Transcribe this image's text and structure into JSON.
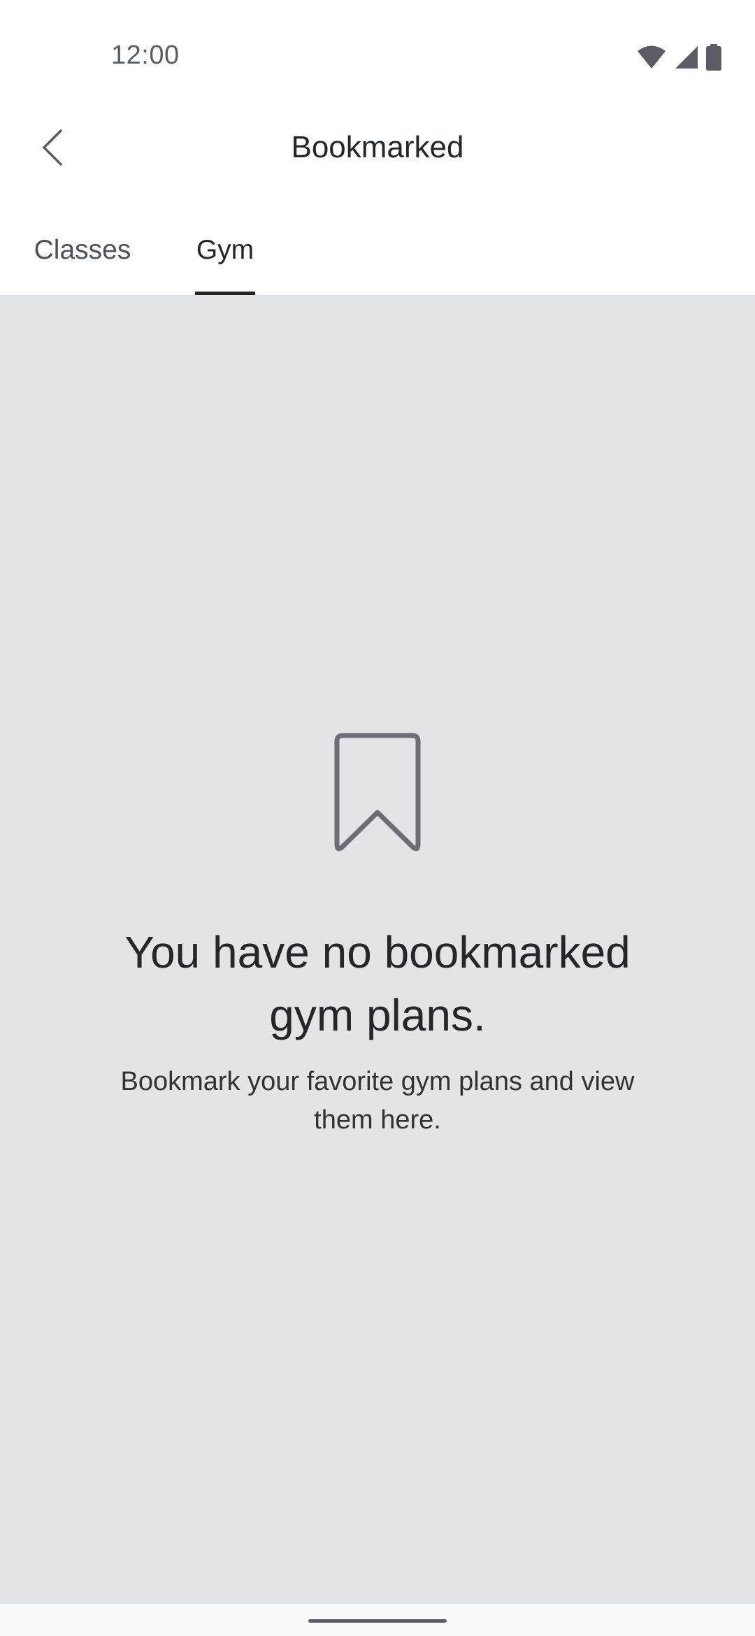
{
  "status_bar": {
    "time": "12:00",
    "icons": [
      "wifi-icon",
      "cell-signal-icon",
      "battery-icon"
    ]
  },
  "app_bar": {
    "title": "Bookmarked",
    "back_icon": "chevron-left-icon"
  },
  "tabs": [
    {
      "label": "Classes",
      "selected": false
    },
    {
      "label": "Gym",
      "selected": true
    }
  ],
  "empty_state": {
    "icon": "bookmark-icon",
    "title": "You have no bookmarked gym plans.",
    "subtitle": "Bookmark your favorite gym plans and view them here."
  },
  "colors": {
    "text_primary": "#23262b",
    "content_background": "#e2e5e8",
    "icon_gray": "#6b6e74"
  }
}
